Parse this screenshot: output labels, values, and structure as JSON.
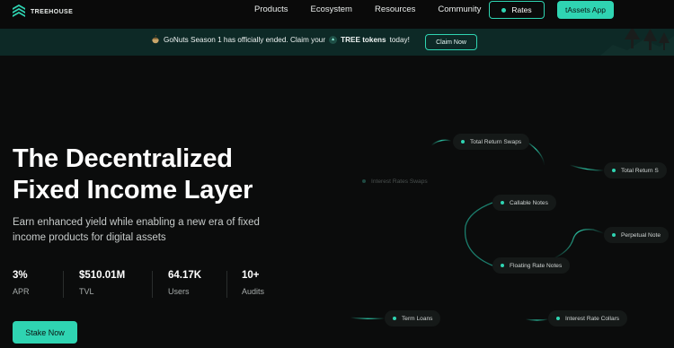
{
  "brand": {
    "name": "TREEHOUSE"
  },
  "nav": {
    "links": [
      "Products",
      "Ecosystem",
      "Resources",
      "Community"
    ],
    "rates_label": "Rates",
    "app_label": "tAssets App"
  },
  "banner": {
    "message_part1": "GoNuts Season 1 has officially ended. Claim your",
    "token_label": "TREE tokens",
    "message_part2": "today!",
    "cta_label": "Claim Now"
  },
  "hero": {
    "title_line1": "The Decentralized",
    "title_line2": "Fixed Income Layer",
    "subtitle_line1": "Earn enhanced yield while enabling a new era of fixed",
    "subtitle_line2": "income products for digital assets",
    "cta_label": "Stake Now"
  },
  "stats": [
    {
      "value": "3%",
      "label": "APR"
    },
    {
      "value": "$510.01M",
      "label": "TVL"
    },
    {
      "value": "64.17K",
      "label": "Users"
    },
    {
      "value": "10+",
      "label": "Audits"
    }
  ],
  "diagram": {
    "nodes": {
      "total_return_swaps": "Total Return Swaps",
      "interest_rates_swaps": "Interest Rates Swaps",
      "total_return_s": "Total Return S",
      "callable_notes": "Callable Notes",
      "perpetual_notes": "Perpetual Note",
      "floating_rate_notes": "Floating Rate Notes",
      "term_loans": "Term Loans",
      "interest_rate_collars": "Interest Rate Collars"
    }
  },
  "colors": {
    "accent": "#2fd4b2",
    "background": "#0b0c0c",
    "banner_bg": "#0d2926"
  },
  "icons": {
    "logo": "treehouse-logo-icon",
    "rates_dot": "status-dot-icon",
    "gonuts": "gonuts-icon",
    "tree_token": "tree-token-icon"
  }
}
